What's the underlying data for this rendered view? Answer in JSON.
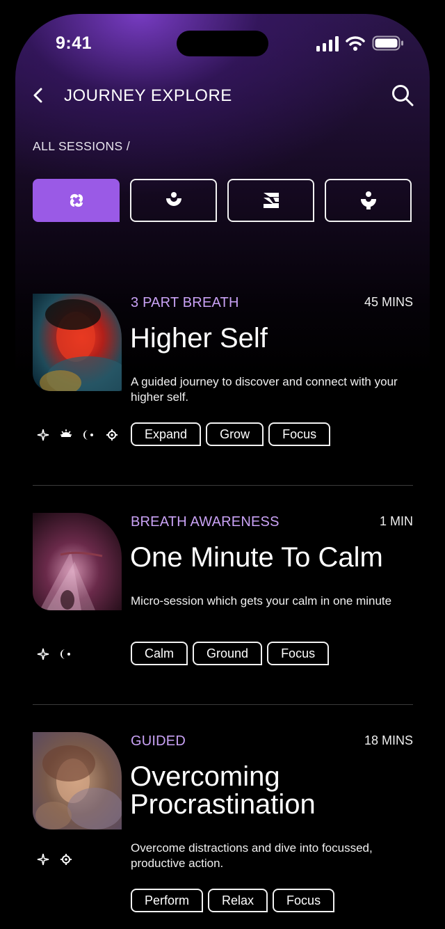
{
  "status_bar": {
    "time": "9:41"
  },
  "header": {
    "title": "JOURNEY EXPLORE",
    "breadcrumb": "ALL SESSIONS /"
  },
  "filter_tabs": [
    {
      "icon": "swirl-icon",
      "active": true
    },
    {
      "icon": "sunrise-smile-icon",
      "active": false
    },
    {
      "icon": "block-s-icon",
      "active": false
    },
    {
      "icon": "person-bowl-icon",
      "active": false
    }
  ],
  "colors": {
    "accent": "#9a5ae6",
    "category_text": "#c9a2f5",
    "background": "#000000"
  },
  "sessions": [
    {
      "category": "3 PART BREATH",
      "duration": "45 MINS",
      "title": "Higher Self",
      "description": "A guided journey to discover and connect with your higher self.",
      "tags": [
        "Expand",
        "Grow",
        "Focus"
      ],
      "icons": [
        "sparkle-icon",
        "sun-eye-icon",
        "moon-phase-icon",
        "gear-icon"
      ]
    },
    {
      "category": "BREATH AWARENESS",
      "duration": "1 MIN",
      "title": "One Minute To Calm",
      "description": "Micro-session which gets your  calm in one minute",
      "tags": [
        "Calm",
        "Ground",
        "Focus"
      ],
      "icons": [
        "sparkle-icon",
        "moon-phase-icon"
      ]
    },
    {
      "category": "GUIDED",
      "duration": "18 MINS",
      "title": "Overcoming Procrastination",
      "description": "Overcome distractions and dive into focussed, productive action.",
      "tags": [
        "Perform",
        "Relax",
        "Focus"
      ],
      "icons": [
        "sparkle-icon",
        "gear-icon"
      ]
    }
  ]
}
